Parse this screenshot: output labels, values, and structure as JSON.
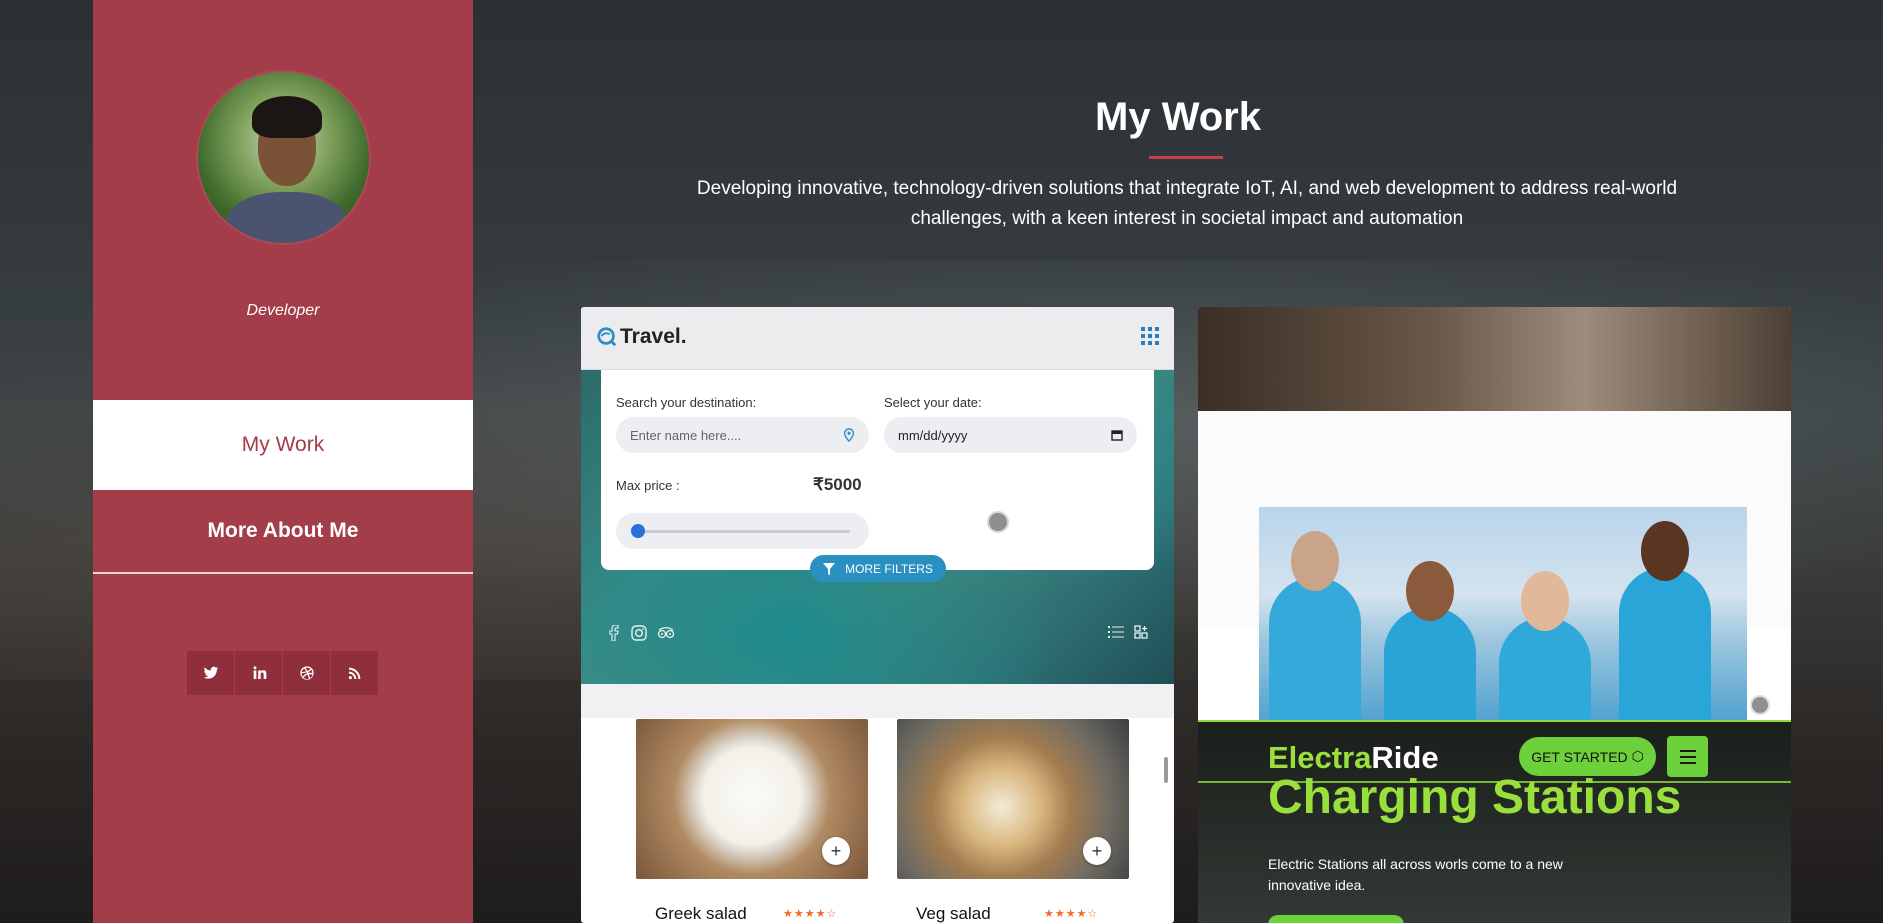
{
  "profile": {
    "role": "Developer"
  },
  "nav": {
    "active": "My Work",
    "items": [
      "More About Me"
    ]
  },
  "socials": [
    "twitter-icon",
    "linkedin-icon",
    "dribbble-icon",
    "rss-icon"
  ],
  "header": {
    "title": "My Work",
    "subtitle": "Developing innovative, technology-driven solutions that integrate IoT, AI, and web development to address real-world challenges, with a keen interest in societal impact and automation"
  },
  "travel": {
    "logo": "Travel.",
    "search_label": "Search your destination:",
    "search_placeholder": "Enter name here....",
    "date_label": "Select your date:",
    "date_value": "mm/dd/yyyy",
    "price_label": "Max price :",
    "price_value": "₹5000",
    "price_slider": 0,
    "more_filters": "MORE FILTERS",
    "foods": [
      {
        "name": "Greek salad",
        "rating": 4
      },
      {
        "name": "Veg salad",
        "rating": 4
      }
    ]
  },
  "electra": {
    "brand_a": "Electra",
    "brand_b": "Ride",
    "get_started": "GET STARTED",
    "headline": "Charging Stations",
    "description": "Electric Stations all across worls come to a new innovative idea."
  },
  "colors": {
    "sidebar": "#a33d49",
    "accent_green": "#9ae03d",
    "travel_blue": "#2a8fc1"
  }
}
